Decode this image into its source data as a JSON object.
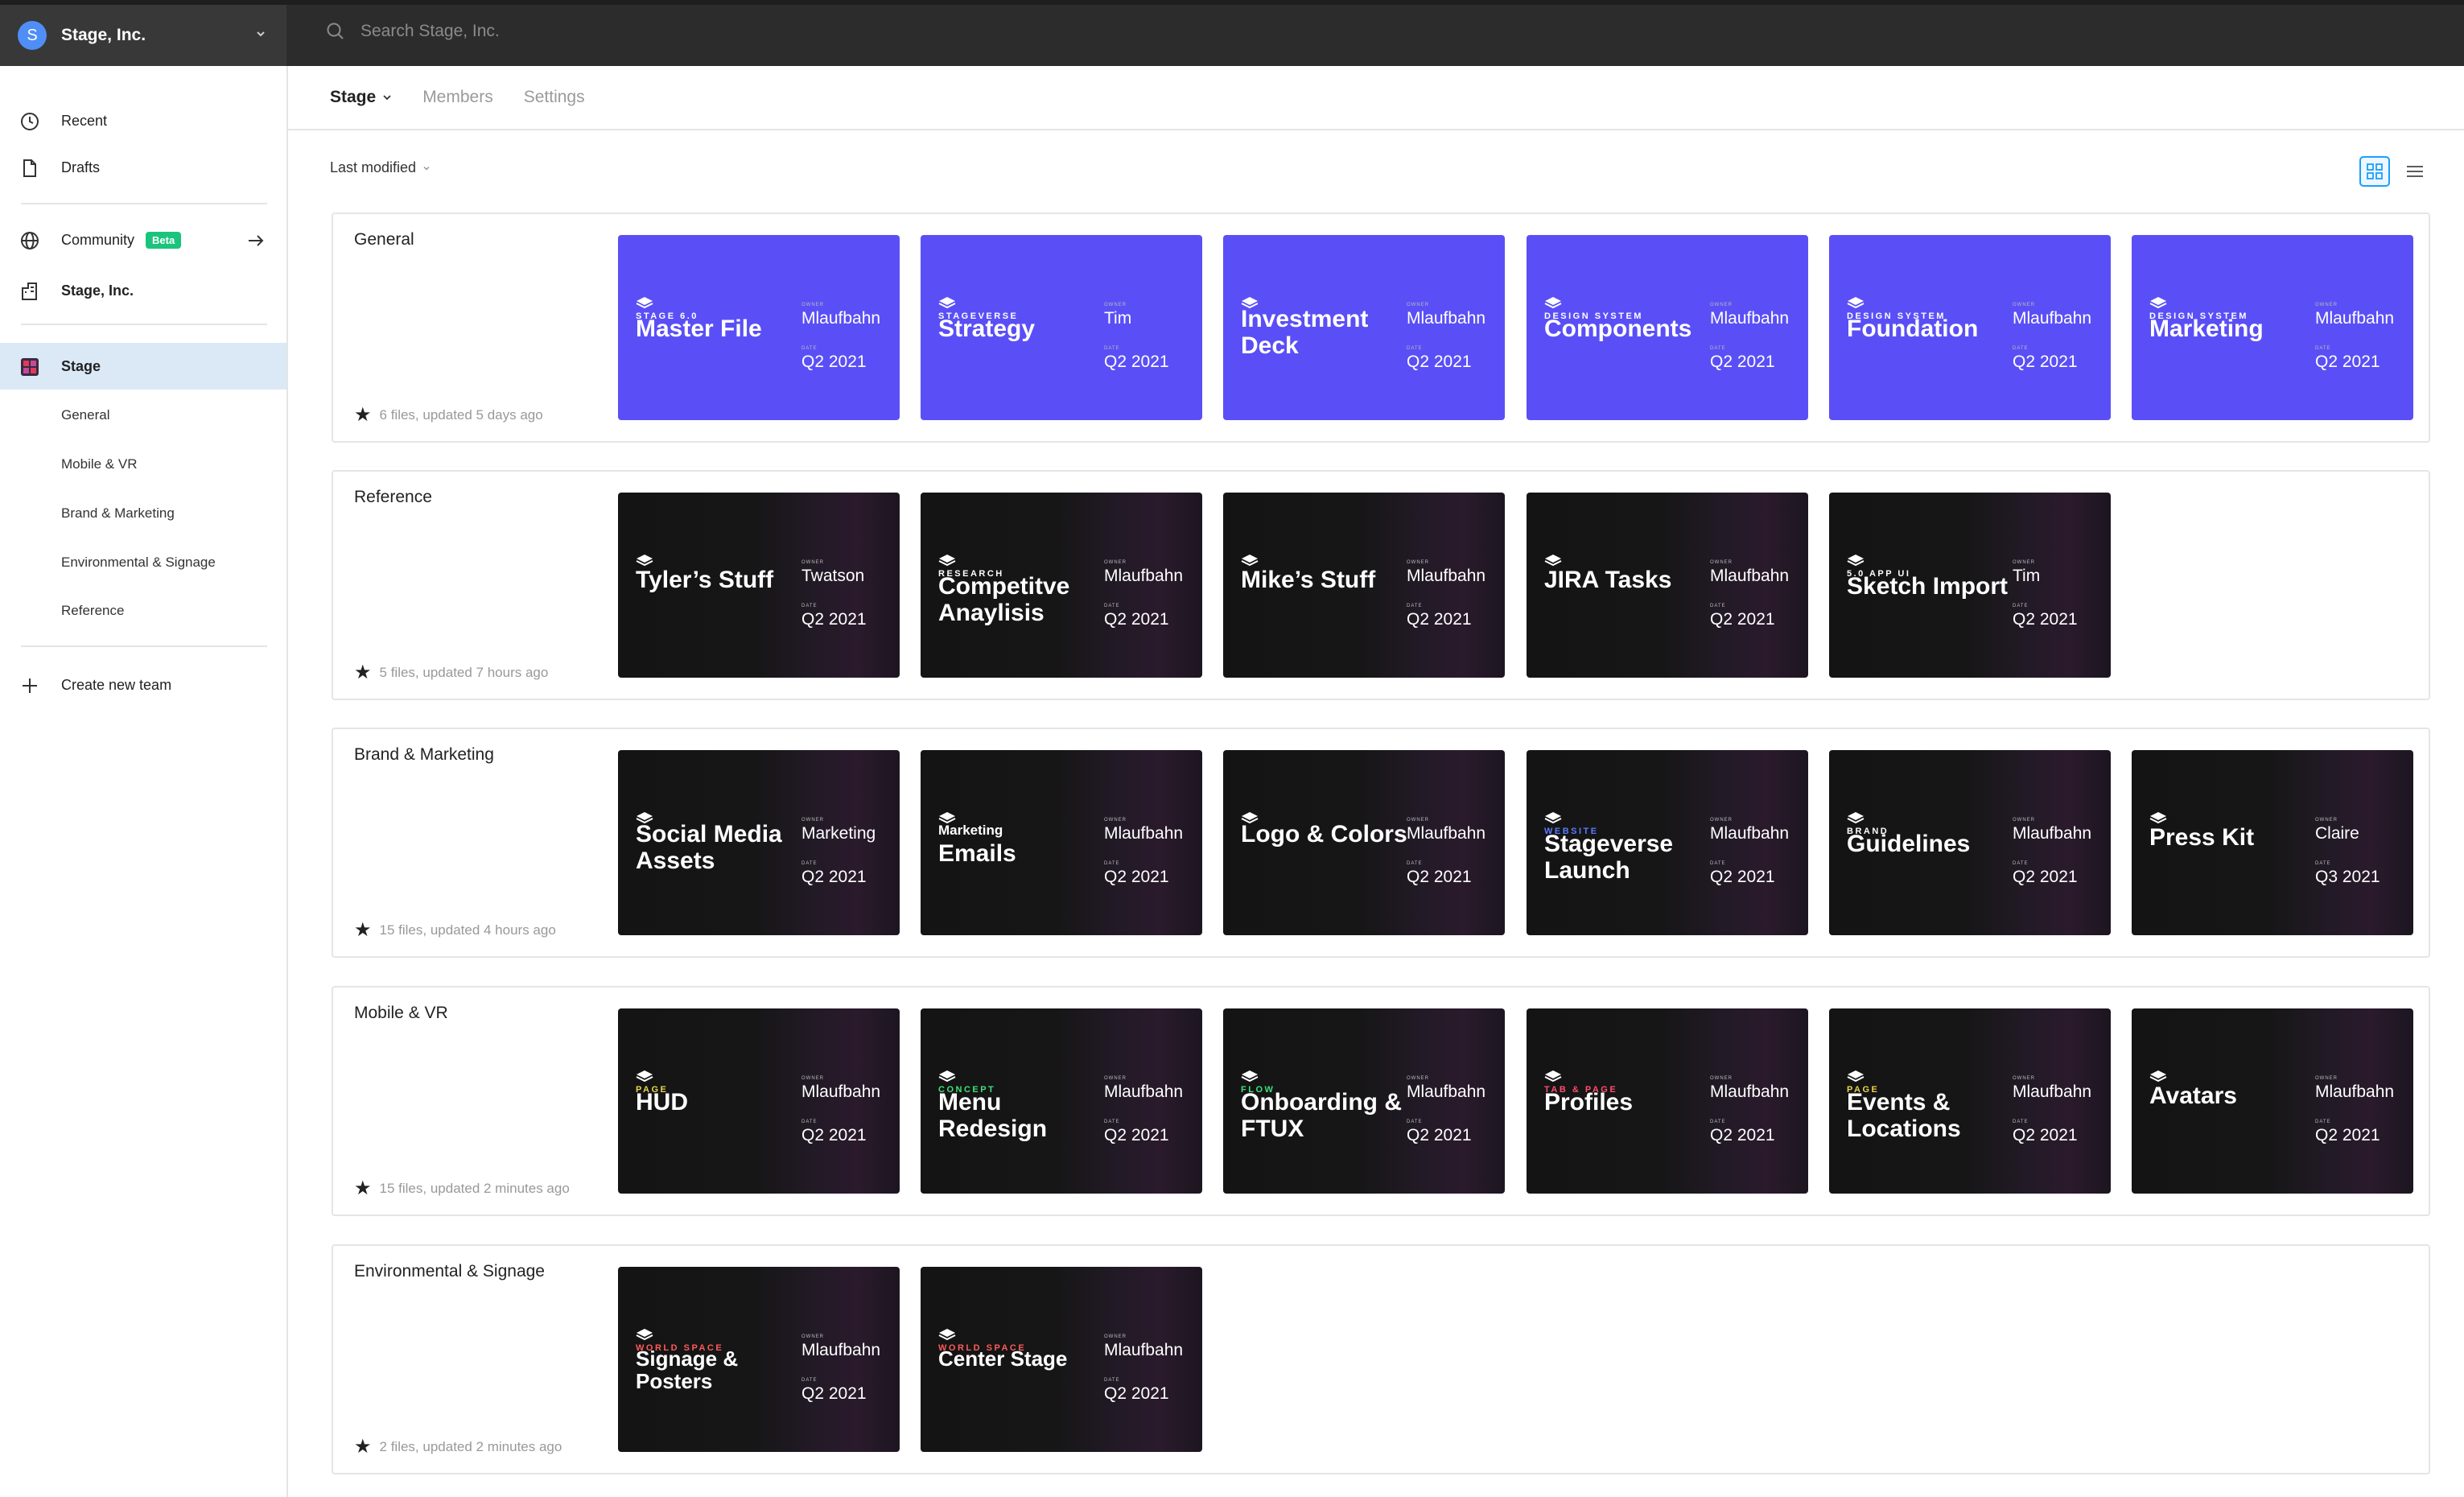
{
  "header": {
    "org_initial": "S",
    "org_name": "Stage, Inc.",
    "search_placeholder": "Search Stage, Inc."
  },
  "sidebar": {
    "recent": "Recent",
    "drafts": "Drafts",
    "community": "Community",
    "beta_badge": "Beta",
    "org": "Stage, Inc.",
    "team": "Stage",
    "projects": [
      "General",
      "Mobile & VR",
      "Brand & Marketing",
      "Environmental & Signage",
      "Reference"
    ],
    "create_team": "Create new team"
  },
  "tabs": [
    "Stage",
    "Members",
    "Settings"
  ],
  "sort_label": "Last modified",
  "labels": {
    "owner": "OWNER",
    "date": "DATE"
  },
  "colors": {
    "accent": "#18a0fb",
    "purple_card": "#5a4ff6",
    "beta": "#1bc47d"
  },
  "projects": [
    {
      "name": "General",
      "meta": "6 files, updated 5 days ago",
      "files": [
        {
          "eyebrow": "STAGE 6.0",
          "title": "Master File",
          "owner": "Mlaufbahn",
          "date": "Q2 2021",
          "style": "purple"
        },
        {
          "eyebrow": "STAGEVERSE",
          "title": "Strategy",
          "owner": "Tim",
          "date": "Q2 2021",
          "style": "purple"
        },
        {
          "eyebrow": "",
          "title": "Investment Deck",
          "owner": "Mlaufbahn",
          "date": "Q2 2021",
          "style": "purple"
        },
        {
          "eyebrow": "DESIGN SYSTEM",
          "title": "Components",
          "owner": "Mlaufbahn",
          "date": "Q2 2021",
          "style": "purple"
        },
        {
          "eyebrow": "DESIGN SYSTEM",
          "title": "Foundation",
          "owner": "Mlaufbahn",
          "date": "Q2 2021",
          "style": "purple"
        },
        {
          "eyebrow": "DESIGN SYSTEM",
          "title": "Marketing",
          "owner": "Mlaufbahn",
          "date": "Q2 2021",
          "style": "purple"
        }
      ]
    },
    {
      "name": "Reference",
      "meta": "5 files, updated 7 hours ago",
      "files": [
        {
          "eyebrow": "",
          "title": "Tyler’s Stuff",
          "owner": "Twatson",
          "date": "Q2 2021",
          "style": "dark"
        },
        {
          "eyebrow": "RESEARCH",
          "title": "Competitve Anaylisis",
          "owner": "Mlaufbahn",
          "date": "Q2 2021",
          "style": "dark",
          "eyebrow_color": "#ffffff"
        },
        {
          "eyebrow": "",
          "title": "Mike’s Stuff",
          "owner": "Mlaufbahn",
          "date": "Q2 2021",
          "style": "dark"
        },
        {
          "eyebrow": "",
          "title": "JIRA Tasks",
          "owner": "Mlaufbahn",
          "date": "Q2 2021",
          "style": "dark"
        },
        {
          "eyebrow": "5.0 APP UI",
          "title": "Sketch Import",
          "owner": "Tim",
          "date": "Q2 2021",
          "style": "dark",
          "eyebrow_color": "#ffffff"
        }
      ]
    },
    {
      "name": "Brand & Marketing",
      "meta": "15 files, updated 4 hours ago",
      "files": [
        {
          "eyebrow": "",
          "title": "Social Media Assets",
          "owner": "Marketing",
          "date": "Q2 2021",
          "style": "dark"
        },
        {
          "eyebrow": "Marketing",
          "title": "Emails",
          "owner": "Mlaufbahn",
          "date": "Q2 2021",
          "style": "dark",
          "eyebrow_color": "#ffffff",
          "eyebrow_big": true
        },
        {
          "eyebrow": "",
          "title": "Logo & Colors",
          "owner": "Mlaufbahn",
          "date": "Q2 2021",
          "style": "dark"
        },
        {
          "eyebrow": "WEBSITE",
          "title": "Stageverse Launch",
          "owner": "Mlaufbahn",
          "date": "Q2 2021",
          "style": "dark",
          "eyebrow_color": "#5a7bff"
        },
        {
          "eyebrow": "BRAND",
          "title": "Guidelines",
          "owner": "Mlaufbahn",
          "date": "Q2 2021",
          "style": "dark",
          "eyebrow_color": "#ffffff"
        },
        {
          "eyebrow": "",
          "title": "Press Kit",
          "owner": "Claire",
          "date": "Q3 2021",
          "style": "dark"
        }
      ]
    },
    {
      "name": "Mobile & VR",
      "meta": "15 files, updated 2 minutes ago",
      "files": [
        {
          "eyebrow": "PAGE",
          "title": "HUD",
          "owner": "Mlaufbahn",
          "date": "Q2 2021",
          "style": "dark",
          "eyebrow_color": "#e8d44d"
        },
        {
          "eyebrow": "CONCEPT",
          "title": "Menu Redesign",
          "owner": "Mlaufbahn",
          "date": "Q2 2021",
          "style": "dark",
          "eyebrow_color": "#3ee07a"
        },
        {
          "eyebrow": "FLOW",
          "title": "Onboarding & FTUX",
          "owner": "Mlaufbahn",
          "date": "Q2 2021",
          "style": "dark",
          "eyebrow_color": "#3ee07a"
        },
        {
          "eyebrow": "TAB & PAGE",
          "title": "Profiles",
          "owner": "Mlaufbahn",
          "date": "Q2 2021",
          "style": "dark",
          "eyebrow_color": "#ff4d6d"
        },
        {
          "eyebrow": "PAGE",
          "title": "Events & Locations",
          "owner": "Mlaufbahn",
          "date": "Q2 2021",
          "style": "dark",
          "eyebrow_color": "#e8d44d"
        },
        {
          "eyebrow": "",
          "title": "Avatars",
          "owner": "Mlaufbahn",
          "date": "Q2 2021",
          "style": "dark"
        }
      ]
    },
    {
      "name": "Environmental & Signage",
      "meta": "2 files, updated 2 minutes ago",
      "files": [
        {
          "eyebrow": "WORLD SPACE",
          "title": "Signage & Posters",
          "owner": "Mlaufbahn",
          "date": "Q2 2021",
          "style": "dark",
          "eyebrow_color": "#ff5a5a",
          "small": true
        },
        {
          "eyebrow": "WORLD SPACE",
          "title": "Center Stage",
          "owner": "Mlaufbahn",
          "date": "Q2 2021",
          "style": "dark",
          "eyebrow_color": "#ff5a5a",
          "small": true
        }
      ]
    }
  ]
}
